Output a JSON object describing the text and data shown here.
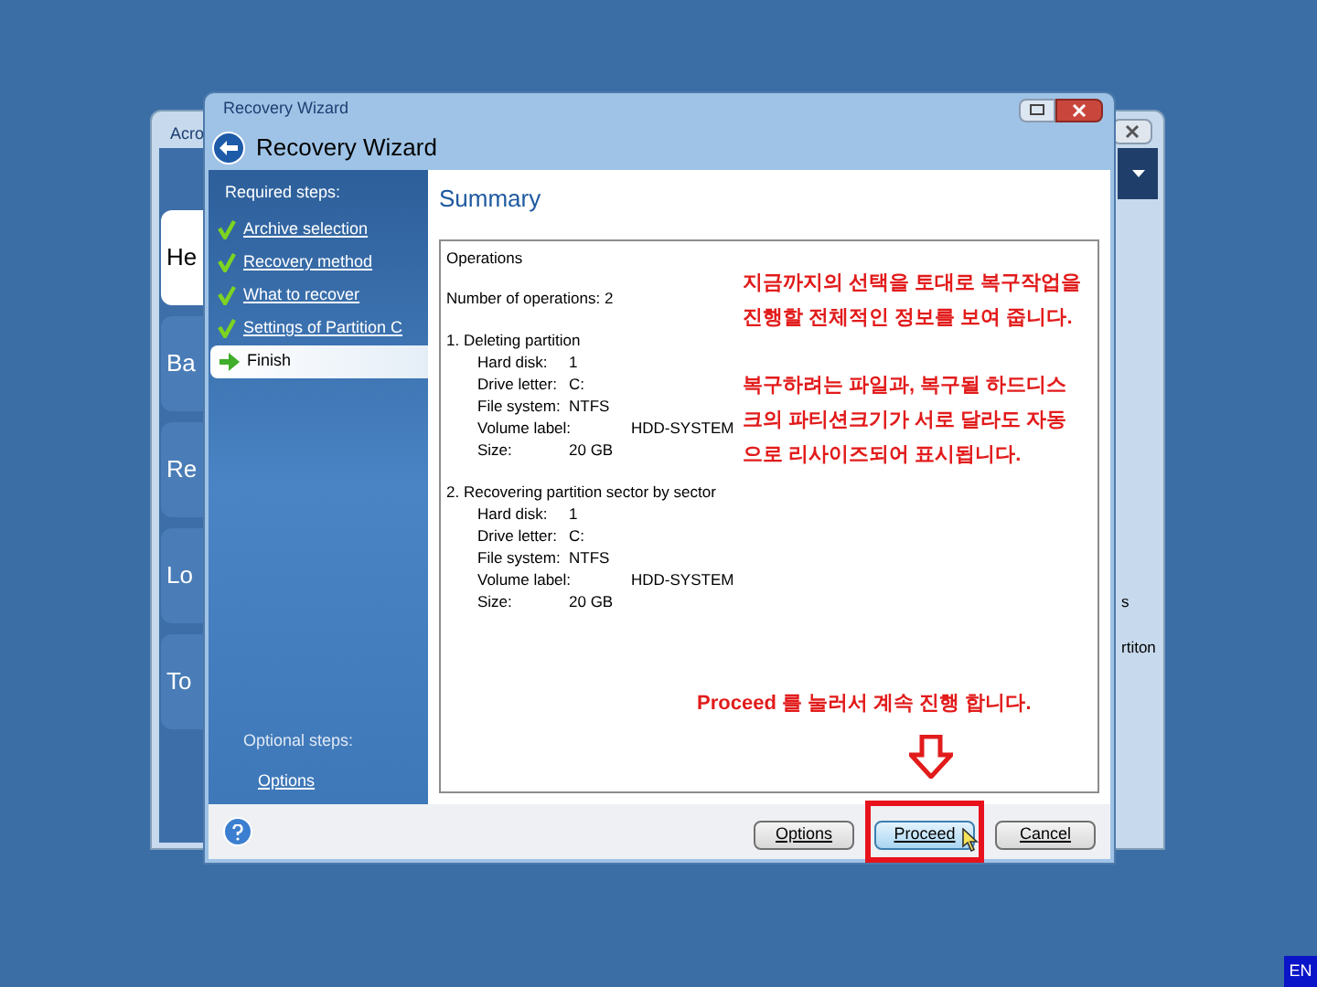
{
  "background_window": {
    "title": "Acro",
    "tiles": [
      "He",
      "Ba",
      "Re",
      "Lo",
      "To"
    ],
    "fragments": [
      "s",
      "rtiton"
    ]
  },
  "wizard": {
    "title": "Recovery Wizard",
    "header": "Recovery Wizard",
    "required_label": "Required steps:",
    "steps": [
      {
        "label": "Archive selection",
        "selected": false
      },
      {
        "label": "Recovery method",
        "selected": false
      },
      {
        "label": "What to recover",
        "selected": false
      },
      {
        "label": "Settings of Partition C",
        "selected": false
      },
      {
        "label": "Finish",
        "selected": true
      }
    ],
    "optional_label": "Optional steps:",
    "optional_items": [
      "Options"
    ],
    "section_title": "Summary",
    "summary": {
      "heading": "Operations",
      "count": "Number of operations: 2",
      "operations": [
        {
          "title": "1. Deleting partition",
          "fields": [
            {
              "label": "Hard disk:",
              "value": "1"
            },
            {
              "label": "Drive letter:",
              "value": "C:"
            },
            {
              "label": "File system:",
              "value": "NTFS"
            },
            {
              "label": "Volume label:",
              "value": "HDD-SYSTEM"
            },
            {
              "label": "Size:",
              "value": "20 GB"
            }
          ]
        },
        {
          "title": "2. Recovering partition sector by sector",
          "fields": [
            {
              "label": "Hard disk:",
              "value": "1"
            },
            {
              "label": "Drive letter:",
              "value": "C:"
            },
            {
              "label": "File system:",
              "value": "NTFS"
            },
            {
              "label": "Volume label:",
              "value": "HDD-SYSTEM"
            },
            {
              "label": "Size:",
              "value": "20 GB"
            }
          ]
        }
      ]
    },
    "buttons": [
      {
        "label": "Options",
        "selected": false
      },
      {
        "label": "Proceed",
        "selected": true
      },
      {
        "label": "Cancel",
        "selected": false
      }
    ]
  },
  "annotations": {
    "paragraphs": [
      "지금까지의 선택을 토대로 복구작업을 진행할 전체적인 정보를 보여 줍니다.",
      "복구하려는 파일과, 복구될 하드디스크의 파티션크기가 서로 달라도 자동으로 리사이즈되어 표시됩니다."
    ],
    "proceed_note": "Proceed 를 눌러서 계속 진행 합니다."
  },
  "language_indicator": "EN"
}
